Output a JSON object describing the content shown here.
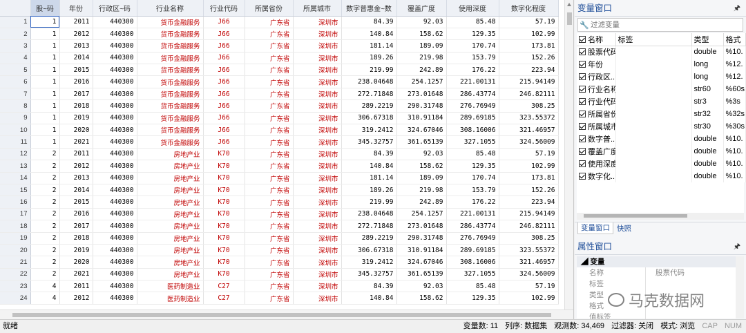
{
  "grid": {
    "columns": [
      {
        "name": "row_no",
        "label": ""
      },
      {
        "name": "stkcd",
        "label": "股~码"
      },
      {
        "name": "year",
        "label": "年份"
      },
      {
        "name": "region",
        "label": "行政区~码"
      },
      {
        "name": "industry",
        "label": "行业名称"
      },
      {
        "name": "indcode",
        "label": "行业代码"
      },
      {
        "name": "province",
        "label": "所属省份"
      },
      {
        "name": "city",
        "label": "所属城市"
      },
      {
        "name": "dfi",
        "label": "数字普惠金~数"
      },
      {
        "name": "coverage",
        "label": "覆盖广度"
      },
      {
        "name": "usage",
        "label": "使用深度"
      },
      {
        "name": "digit",
        "label": "数字化程度"
      }
    ],
    "rows": [
      [
        "1",
        "1",
        "2011",
        "440300",
        "货币金融服务",
        "J66",
        "广东省",
        "深圳市",
        "84.39",
        "92.03",
        "85.48",
        "57.19"
      ],
      [
        "2",
        "1",
        "2012",
        "440300",
        "货币金融服务",
        "J66",
        "广东省",
        "深圳市",
        "140.84",
        "158.62",
        "129.35",
        "102.99"
      ],
      [
        "3",
        "1",
        "2013",
        "440300",
        "货币金融服务",
        "J66",
        "广东省",
        "深圳市",
        "181.14",
        "189.09",
        "170.74",
        "173.81"
      ],
      [
        "4",
        "1",
        "2014",
        "440300",
        "货币金融服务",
        "J66",
        "广东省",
        "深圳市",
        "189.26",
        "219.98",
        "153.79",
        "152.26"
      ],
      [
        "5",
        "1",
        "2015",
        "440300",
        "货币金融服务",
        "J66",
        "广东省",
        "深圳市",
        "219.99",
        "242.89",
        "176.22",
        "223.94"
      ],
      [
        "6",
        "1",
        "2016",
        "440300",
        "货币金融服务",
        "J66",
        "广东省",
        "深圳市",
        "238.04648",
        "254.1257",
        "221.00131",
        "215.94149"
      ],
      [
        "7",
        "1",
        "2017",
        "440300",
        "货币金融服务",
        "J66",
        "广东省",
        "深圳市",
        "272.71848",
        "273.01648",
        "286.43774",
        "246.82111"
      ],
      [
        "8",
        "1",
        "2018",
        "440300",
        "货币金融服务",
        "J66",
        "广东省",
        "深圳市",
        "289.2219",
        "290.31748",
        "276.76949",
        "308.25"
      ],
      [
        "9",
        "1",
        "2019",
        "440300",
        "货币金融服务",
        "J66",
        "广东省",
        "深圳市",
        "306.67318",
        "310.91184",
        "289.69185",
        "323.55372"
      ],
      [
        "10",
        "1",
        "2020",
        "440300",
        "货币金融服务",
        "J66",
        "广东省",
        "深圳市",
        "319.2412",
        "324.67046",
        "308.16006",
        "321.46957"
      ],
      [
        "11",
        "1",
        "2021",
        "440300",
        "货币金融服务",
        "J66",
        "广东省",
        "深圳市",
        "345.32757",
        "361.65139",
        "327.1055",
        "324.56009"
      ],
      [
        "12",
        "2",
        "2011",
        "440300",
        "房地产业",
        "K70",
        "广东省",
        "深圳市",
        "84.39",
        "92.03",
        "85.48",
        "57.19"
      ],
      [
        "13",
        "2",
        "2012",
        "440300",
        "房地产业",
        "K70",
        "广东省",
        "深圳市",
        "140.84",
        "158.62",
        "129.35",
        "102.99"
      ],
      [
        "14",
        "2",
        "2013",
        "440300",
        "房地产业",
        "K70",
        "广东省",
        "深圳市",
        "181.14",
        "189.09",
        "170.74",
        "173.81"
      ],
      [
        "15",
        "2",
        "2014",
        "440300",
        "房地产业",
        "K70",
        "广东省",
        "深圳市",
        "189.26",
        "219.98",
        "153.79",
        "152.26"
      ],
      [
        "16",
        "2",
        "2015",
        "440300",
        "房地产业",
        "K70",
        "广东省",
        "深圳市",
        "219.99",
        "242.89",
        "176.22",
        "223.94"
      ],
      [
        "17",
        "2",
        "2016",
        "440300",
        "房地产业",
        "K70",
        "广东省",
        "深圳市",
        "238.04648",
        "254.1257",
        "221.00131",
        "215.94149"
      ],
      [
        "18",
        "2",
        "2017",
        "440300",
        "房地产业",
        "K70",
        "广东省",
        "深圳市",
        "272.71848",
        "273.01648",
        "286.43774",
        "246.82111"
      ],
      [
        "19",
        "2",
        "2018",
        "440300",
        "房地产业",
        "K70",
        "广东省",
        "深圳市",
        "289.2219",
        "290.31748",
        "276.76949",
        "308.25"
      ],
      [
        "20",
        "2",
        "2019",
        "440300",
        "房地产业",
        "K70",
        "广东省",
        "深圳市",
        "306.67318",
        "310.91184",
        "289.69185",
        "323.55372"
      ],
      [
        "21",
        "2",
        "2020",
        "440300",
        "房地产业",
        "K70",
        "广东省",
        "深圳市",
        "319.2412",
        "324.67046",
        "308.16006",
        "321.46957"
      ],
      [
        "22",
        "2",
        "2021",
        "440300",
        "房地产业",
        "K70",
        "广东省",
        "深圳市",
        "345.32757",
        "361.65139",
        "327.1055",
        "324.56009"
      ],
      [
        "23",
        "4",
        "2011",
        "440300",
        "医药制造业",
        "C27",
        "广东省",
        "深圳市",
        "84.39",
        "92.03",
        "85.48",
        "57.19"
      ],
      [
        "24",
        "4",
        "2012",
        "440300",
        "医药制造业",
        "C27",
        "广东省",
        "深圳市",
        "140.84",
        "158.62",
        "129.35",
        "102.99"
      ]
    ]
  },
  "variables_panel": {
    "title": "变量窗口",
    "filter_placeholder": "过滤变量",
    "headers": {
      "name": "名称",
      "label": "标签",
      "type": "类型",
      "format": "格式"
    },
    "vars": [
      {
        "name": "股票代码",
        "type": "double",
        "format": "%10."
      },
      {
        "name": "年份",
        "type": "long",
        "format": "%12."
      },
      {
        "name": "行政区...",
        "type": "long",
        "format": "%12."
      },
      {
        "name": "行业名称",
        "type": "str60",
        "format": "%60s"
      },
      {
        "name": "行业代码",
        "type": "str3",
        "format": "%3s"
      },
      {
        "name": "所属省份",
        "type": "str32",
        "format": "%32s"
      },
      {
        "name": "所属城市",
        "type": "str30",
        "format": "%30s"
      },
      {
        "name": "数字普...",
        "type": "double",
        "format": "%10."
      },
      {
        "name": "覆盖广度",
        "type": "double",
        "format": "%10."
      },
      {
        "name": "使用深度",
        "type": "double",
        "format": "%10."
      },
      {
        "name": "数字化...",
        "type": "double",
        "format": "%10."
      }
    ],
    "tabs": [
      "变量窗口",
      "快照"
    ]
  },
  "properties_panel": {
    "title": "属性窗口",
    "section": "变量",
    "rows": [
      {
        "k": "名称",
        "v": "股票代码"
      },
      {
        "k": "标签",
        "v": ""
      },
      {
        "k": "类型",
        "v": ""
      },
      {
        "k": "格式",
        "v": ""
      },
      {
        "k": "值标签",
        "v": ""
      }
    ]
  },
  "watermark": "马克数据网",
  "status": {
    "left": "就绪",
    "vars": "变量数: 11",
    "sort": "列序: 数据集",
    "obs": "观测数: 34,469",
    "filter": "过滤器: 关闭",
    "mode": "模式: 浏览",
    "cap": "CAP",
    "num": "NUM"
  },
  "colors": {
    "string_text": "#c00000",
    "panel_title": "#1f4e99"
  }
}
